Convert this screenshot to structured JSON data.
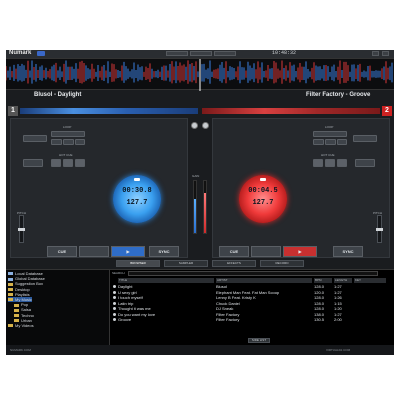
{
  "app": {
    "logo": "Numark"
  },
  "topbar": {
    "clock": "10:48:32"
  },
  "decks": {
    "left": {
      "title": "Blusol - Daylight",
      "number": "1",
      "time": "00:30.8",
      "bpm": "127.7",
      "loop_label": "LOOP",
      "hotcue_label": "HOT CUE",
      "pitch_label": "PITCH",
      "cue": "CUE",
      "play": "▶",
      "sync": "SYNC"
    },
    "right": {
      "title": "Filter Factory - Groove",
      "number": "2",
      "time": "00:04.5",
      "bpm": "127.7",
      "loop_label": "LOOP",
      "hotcue_label": "HOT CUE",
      "pitch_label": "PITCH",
      "cue": "CUE",
      "play": "▶",
      "sync": "SYNC"
    }
  },
  "mixer": {
    "gain_label": "GAIN"
  },
  "tabs": [
    "BROWSER",
    "SAMPLER",
    "EFFECTS",
    "RECORD"
  ],
  "browser": {
    "search_label": "SEARCH",
    "folders": [
      {
        "label": "Local Database",
        "icon": "database-icon"
      },
      {
        "label": "Global Database",
        "icon": "database-icon"
      },
      {
        "label": "Suggestion Box",
        "icon": "folder-icon"
      },
      {
        "label": "Desktop",
        "icon": "folder-icon"
      },
      {
        "label": "Playlists",
        "icon": "folder-icon"
      },
      {
        "label": "My Music",
        "icon": "folder-icon"
      },
      {
        "label": "Pop",
        "icon": "folder-icon"
      },
      {
        "label": "Salsa",
        "icon": "folder-icon"
      },
      {
        "label": "Techno",
        "icon": "folder-icon"
      },
      {
        "label": "Urban",
        "icon": "folder-icon"
      },
      {
        "label": "My Videos",
        "icon": "folder-icon"
      }
    ],
    "columns": [
      "TITLE",
      "ARTIST",
      "BPM",
      "LENGTH",
      "KEY"
    ],
    "rows": [
      {
        "title": "Daylight",
        "artist": "Blusol",
        "bpm": "128.0",
        "length": "1:27"
      },
      {
        "title": "U sexy girl",
        "artist": "Elephant Man Feat. Fat Man Scoop",
        "bpm": "120.0",
        "length": "1:27"
      },
      {
        "title": "I touch myself",
        "artist": "Lenny B Feat. Kristy K",
        "bpm": "128.0",
        "length": "1:26"
      },
      {
        "title": "Latin trip",
        "artist": "Chuck Daniel",
        "bpm": "128.0",
        "length": "1:15"
      },
      {
        "title": "Thought it was me",
        "artist": "DJ Sneak",
        "bpm": "128.0",
        "length": "1:20"
      },
      {
        "title": "Do you want my love",
        "artist": "Filter Factory",
        "bpm": "138.0",
        "length": "1:27"
      },
      {
        "title": "Groove",
        "artist": "Filter Factory",
        "bpm": "130.5",
        "length": "2:00"
      }
    ],
    "side_list": "SIDE LIST"
  },
  "status": {
    "left": "NUMARK.COM",
    "right": "VIRTUALDJ.COM"
  },
  "colors": {
    "deck_left_accent": "#3aa0f0",
    "deck_right_accent": "#f03a3a"
  }
}
